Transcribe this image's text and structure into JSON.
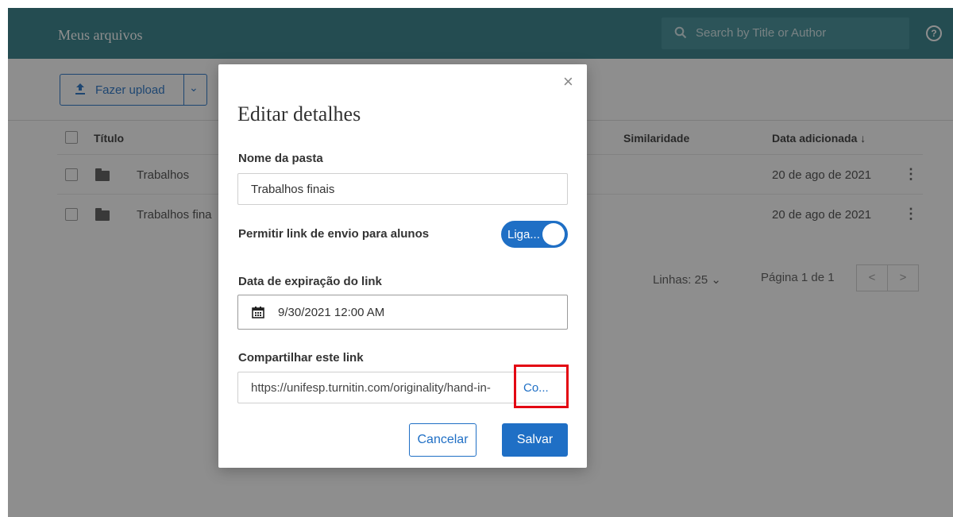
{
  "header": {
    "title": "Meus arquivos",
    "search_placeholder": "Search by Title or Author",
    "help_label": "?"
  },
  "toolbar": {
    "upload_label": "Fazer upload",
    "upload_icon": "upload-arrow-icon"
  },
  "table": {
    "columns": {
      "title": "Título",
      "similarity": "Similaridade",
      "date_added": "Data adicionada ↓"
    },
    "rows": [
      {
        "name": "Trabalhos",
        "date": "20 de ago de 2021"
      },
      {
        "name": "Trabalhos fina",
        "date": "20 de ago de 2021"
      }
    ]
  },
  "pagination": {
    "rows_label": "Linhas: 25",
    "page_label": "Página 1 de 1",
    "prev": "<",
    "next": ">"
  },
  "modal": {
    "title": "Editar detalhes",
    "close_label": "×",
    "folder_name_label": "Nome da pasta",
    "folder_name_value": "Trabalhos finais",
    "allow_link_label": "Permitir link de envio para alunos",
    "toggle_label": "Liga...",
    "toggle_on": true,
    "expiration_label": "Data de expiração do link",
    "expiration_value": "9/30/2021 12:00 AM",
    "share_label": "Compartilhar este link",
    "share_value": "https://unifesp.turnitin.com/originality/hand-in-",
    "copy_label": "Co...",
    "cancel_label": "Cancelar",
    "save_label": "Salvar"
  },
  "colors": {
    "header_bg": "#2b7a85",
    "accent": "#1f6fc5",
    "highlight": "#e30613"
  }
}
